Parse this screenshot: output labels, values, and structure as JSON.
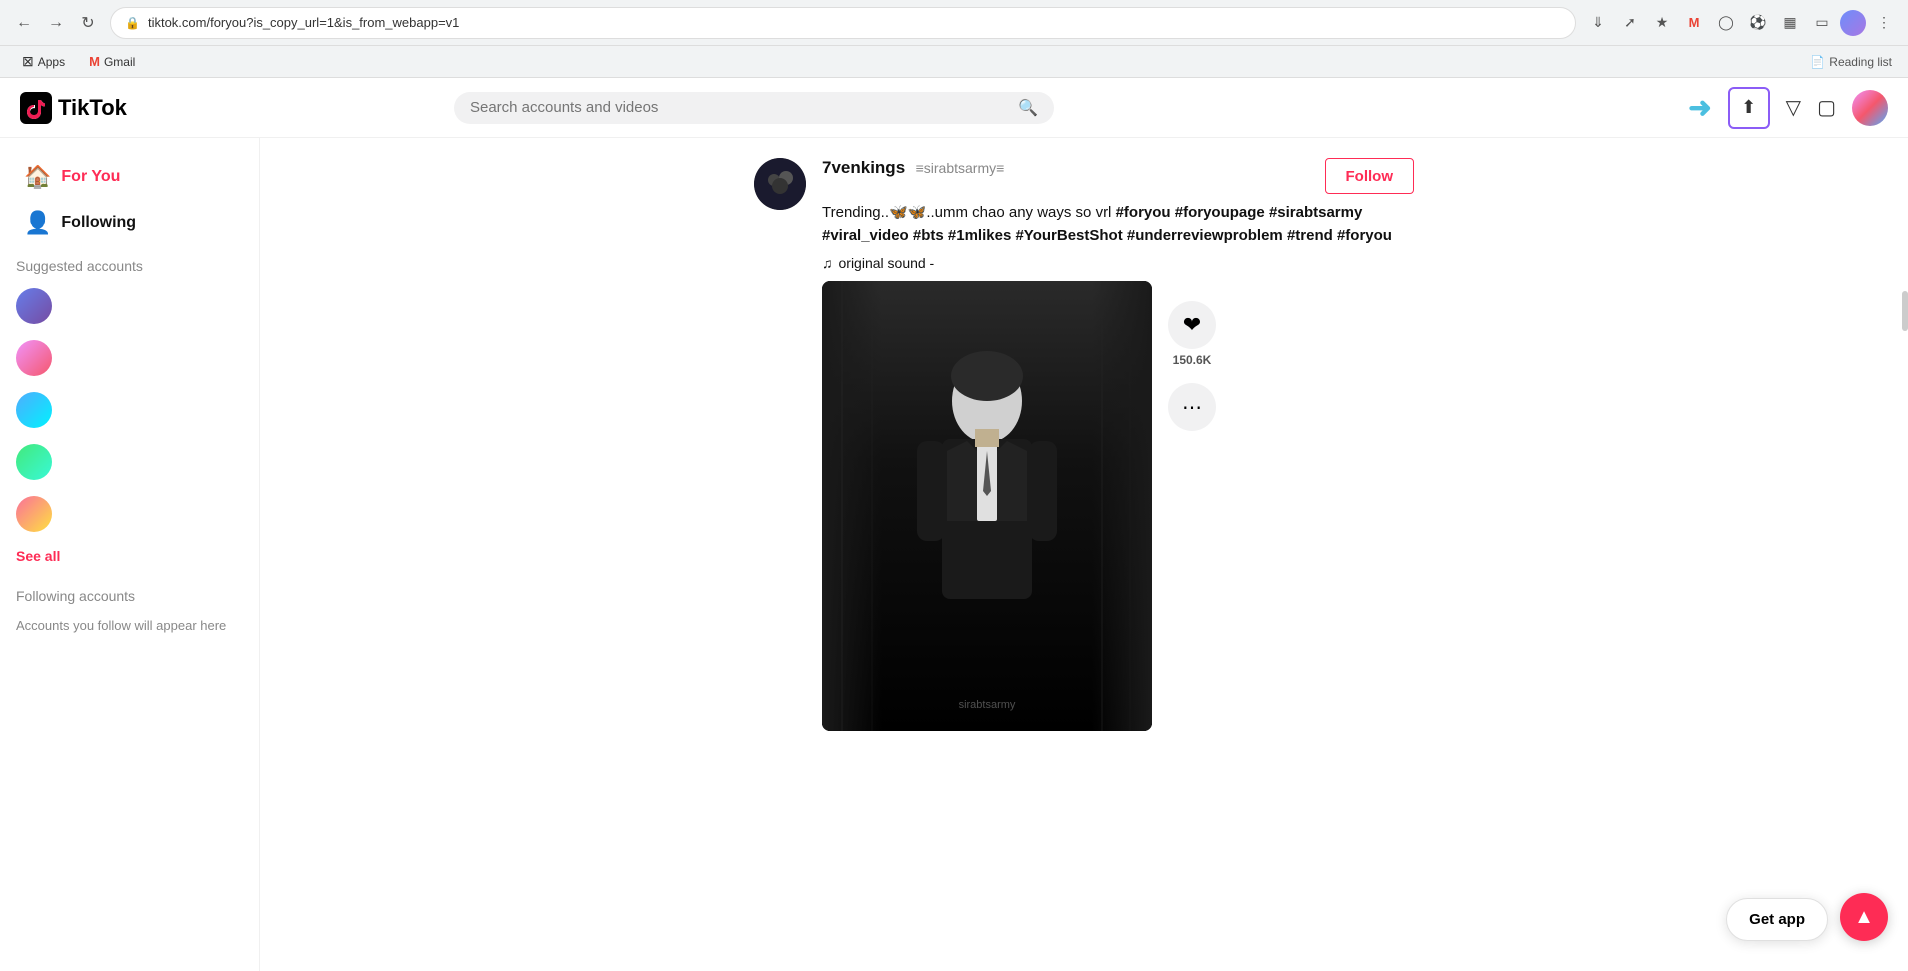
{
  "browser": {
    "back_disabled": false,
    "forward_disabled": false,
    "url": "tiktok.com/foryou?is_copy_url=1&is_from_webapp=v1",
    "bookmarks": [
      {
        "id": "apps",
        "label": "Apps",
        "icon": "⊞"
      },
      {
        "id": "gmail",
        "label": "Gmail",
        "icon": "M"
      }
    ],
    "reading_list_label": "Reading list"
  },
  "header": {
    "logo_text": "TikTok",
    "search_placeholder": "Search accounts and videos",
    "upload_label": "Upload",
    "nav_icons": {
      "upload": "⬆",
      "filter": "▽",
      "message": "☐"
    }
  },
  "sidebar": {
    "nav_items": [
      {
        "id": "for-you",
        "label": "For You",
        "icon": "🏠",
        "active": true
      },
      {
        "id": "following",
        "label": "Following",
        "icon": "👤",
        "active": false
      }
    ],
    "suggested_accounts_title": "Suggested accounts",
    "accounts": [
      {
        "id": "acc1",
        "avatar_class": "avatar-1"
      },
      {
        "id": "acc2",
        "avatar_class": "avatar-2"
      },
      {
        "id": "acc3",
        "avatar_class": "avatar-3"
      },
      {
        "id": "acc4",
        "avatar_class": "avatar-4"
      },
      {
        "id": "acc5",
        "avatar_class": "avatar-5"
      }
    ],
    "see_all_label": "See all",
    "following_accounts_title": "Following accounts",
    "following_empty_text": "Accounts you follow will appear here"
  },
  "post": {
    "username": "7venkings",
    "handle": "≡sirabtsarmy≡",
    "description": "Trending..🦋🦋..umm chao any ways so vrl #foryou #foryoupage #sirabtsarmy #viral_video #bts #1mlikes #YourBestShot #underreviewproblem #trend #foryou",
    "sound": "original sound -",
    "sound_icon": "♪",
    "follow_label": "Follow",
    "likes_count": "150.6K",
    "watermark": "sirabtsarmy",
    "more_icon": "···"
  },
  "floating": {
    "get_app_label": "Get app",
    "scroll_top_icon": "▲"
  }
}
